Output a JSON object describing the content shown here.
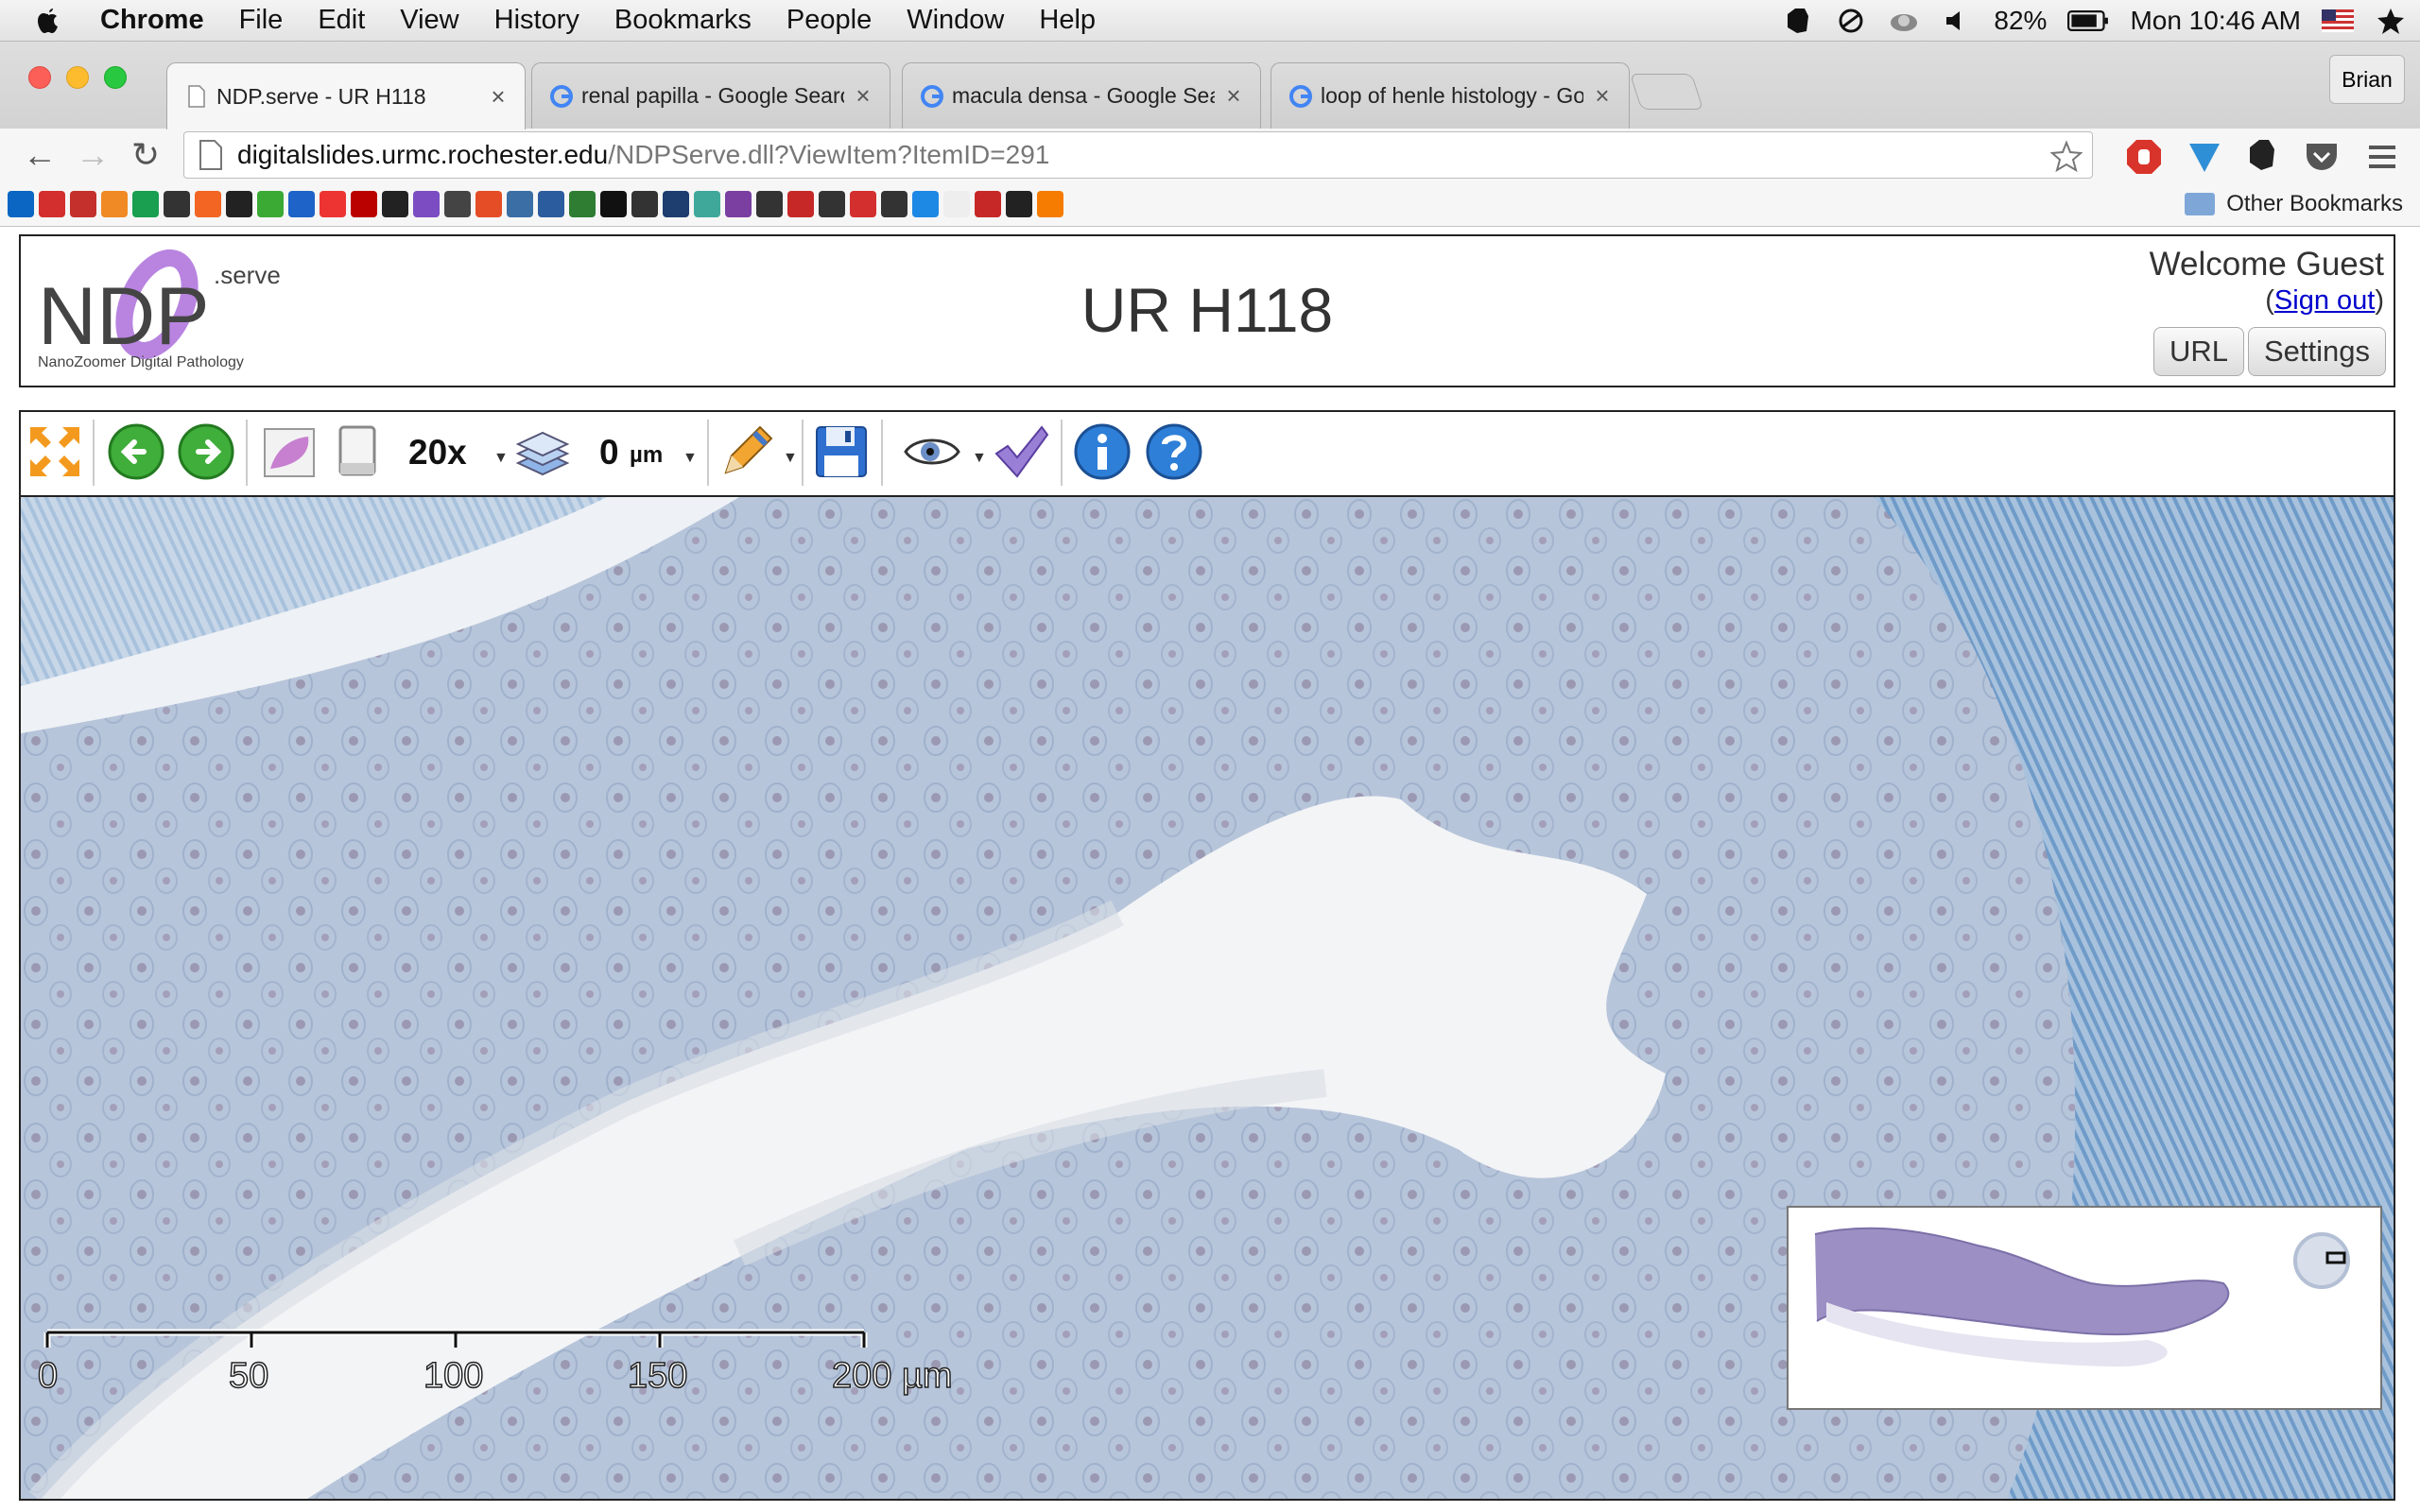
{
  "menubar": {
    "app": "Chrome",
    "items": [
      "File",
      "Edit",
      "View",
      "History",
      "Bookmarks",
      "People",
      "Window",
      "Help"
    ],
    "battery": "82%",
    "clock": "Mon 10:46 AM"
  },
  "tabs": [
    {
      "title": "NDP.serve - UR H118",
      "active": true
    },
    {
      "title": "renal papilla - Google Search",
      "active": false
    },
    {
      "title": "macula densa - Google Search",
      "active": false
    },
    {
      "title": "loop of henle histology - Google Search",
      "active": false
    }
  ],
  "tab_close": "×",
  "profile": "Brian",
  "address": {
    "host": "digitalslides.urmc.rochester.edu",
    "path": "/NDPServe.dll?ViewItem?ItemID=291"
  },
  "bookmarks": {
    "other": "Other Bookmarks",
    "icons": [
      "linkedin",
      "red-bars",
      "stripes",
      "g-orange",
      "m-green",
      "news",
      "y-combinator",
      "vb",
      "u-green",
      "plus-blue",
      "pinwheel",
      "grid-red",
      "h-star",
      "dots",
      "app-press",
      "tomato",
      "database",
      "h-blue",
      "chart-green",
      "bow",
      "zigzag",
      "octopus",
      "molecule",
      "dna",
      "feather",
      "bar-red",
      "bird",
      "it-red",
      "eye-ball",
      "csharp",
      "blank-page",
      "bu-red",
      "cross",
      "hexagon-orange"
    ]
  },
  "header": {
    "logo_text": "NDP",
    "logo_serve": ".serve",
    "logo_caption": "NanoZoomer Digital Pathology",
    "title": "UR H118",
    "welcome": "Welcome Guest",
    "sign_out": "Sign out",
    "paren_open": "(",
    "paren_close": ")",
    "url_button": "URL",
    "settings_button": "Settings"
  },
  "viewer_toolbar": {
    "magnification": "20x",
    "focus_value": "0",
    "focus_unit": "µm"
  },
  "scale_bar": {
    "ticks": [
      "0",
      "50",
      "100",
      "150",
      "200 µm"
    ]
  },
  "colors": {
    "stain_blue": "#7fa6cf",
    "tissue_bg": "#b8c7dc",
    "lumen": "#f3f4f6",
    "thumbnail_tissue": "#9b8fc4"
  }
}
